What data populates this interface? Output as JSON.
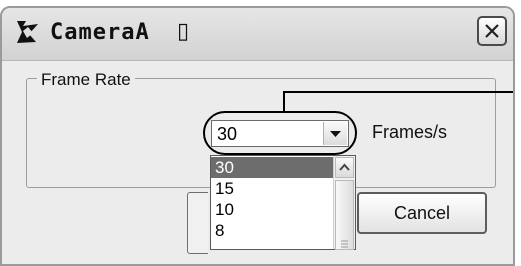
{
  "window": {
    "title": "CameraA",
    "title_glyph": "▯",
    "close_icon": "close-icon"
  },
  "group": {
    "label": "Frame Rate"
  },
  "frame_rate": {
    "selected": "30",
    "unit_label": "Frames/s",
    "options": [
      "30",
      "15",
      "10",
      "8"
    ],
    "selected_index": 0
  },
  "buttons": {
    "cancel_label": "Cancel"
  },
  "icons": {
    "app": "camera-app-icon",
    "dropdown": "chevron-down-icon",
    "scroll_up": "scroll-up-arrow-icon"
  }
}
